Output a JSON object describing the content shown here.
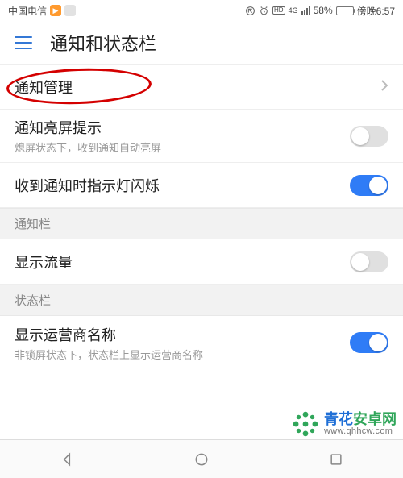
{
  "statusbar": {
    "carrier": "中国电信",
    "battery_pct": "58%",
    "time": "傍晚6:57",
    "net_label": "4G"
  },
  "header": {
    "title": "通知和状态栏"
  },
  "rows": {
    "notif_mgmt": {
      "title": "通知管理"
    },
    "bright_on_notif": {
      "title": "通知亮屏提示",
      "subtitle": "熄屏状态下，收到通知自动亮屏"
    },
    "led_blink": {
      "title": "收到通知时指示灯闪烁"
    },
    "show_traffic": {
      "title": "显示流量"
    },
    "show_carrier": {
      "title": "显示运营商名称",
      "subtitle": "非锁屏状态下，状态栏上显示运营商名称"
    }
  },
  "sections": {
    "notif_bar": "通知栏",
    "status_bar": "状态栏"
  },
  "toggles": {
    "bright_on_notif": false,
    "led_blink": true,
    "show_traffic": false,
    "show_carrier": true
  },
  "watermark": {
    "brand_blue": "青花",
    "brand_green": "安卓网",
    "url": "www.qhhcw.com"
  }
}
